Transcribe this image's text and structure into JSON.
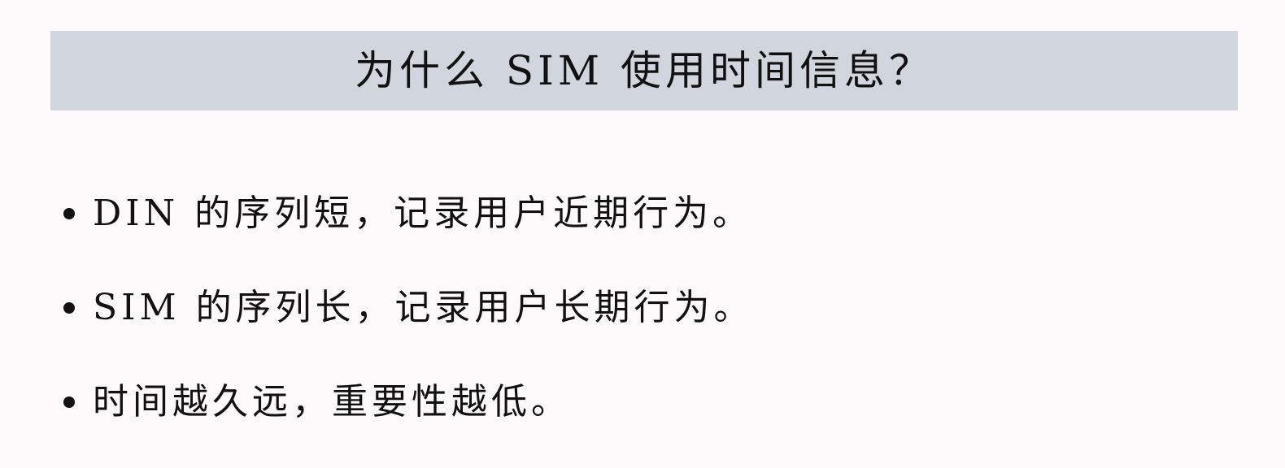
{
  "slide": {
    "title": "为什么 SIM 使用时间信息？",
    "bullets": [
      {
        "text": "DIN 的序列短，记录用户近期行为。"
      },
      {
        "text": "SIM 的序列长，记录用户长期行为。"
      },
      {
        "text": "时间越久远，重要性越低。"
      }
    ]
  },
  "colors": {
    "background": "#fcfafb",
    "title_bar": "#d1d5de",
    "text": "#111111"
  }
}
